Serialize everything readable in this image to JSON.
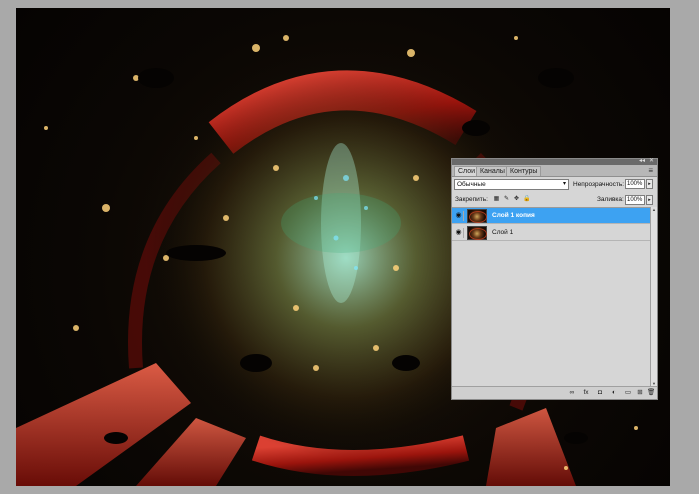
{
  "panel": {
    "tabs": [
      {
        "label": "Слои"
      },
      {
        "label": "Каналы"
      },
      {
        "label": "Контуры"
      }
    ],
    "topbar_arrows": "◂◂",
    "topbar_close": "✕",
    "menu_icon": "≡",
    "blend_mode": "Обычные",
    "blend_arrow": "▾",
    "opacity_label": "Непрозрачность:",
    "opacity_value": "100%",
    "lock_label": "Закрепить:",
    "fill_label": "Заливка:",
    "fill_value": "100%",
    "stepper_glyph": "▸",
    "layers": [
      {
        "name": "Слой 1 копия",
        "selected": true,
        "visible_glyph": "◉"
      },
      {
        "name": "Слой 1",
        "selected": false,
        "visible_glyph": "◉"
      }
    ],
    "lock_icons": [
      "lock-transparent-icon",
      "lock-brush-icon",
      "lock-move-icon",
      "lock-all-icon"
    ],
    "footer_icons": [
      "link-icon",
      "fx-icon",
      "mask-icon",
      "adjustment-icon",
      "group-icon",
      "new-layer-icon",
      "trash-icon"
    ],
    "footer_glyphs": [
      "∞",
      "fx",
      "◘",
      "◐",
      "▭",
      "⊞",
      "🗑"
    ],
    "lock_glyphs": [
      "▦",
      "✎",
      "✥",
      "🔒"
    ],
    "accent_color": "#3da2f2"
  }
}
